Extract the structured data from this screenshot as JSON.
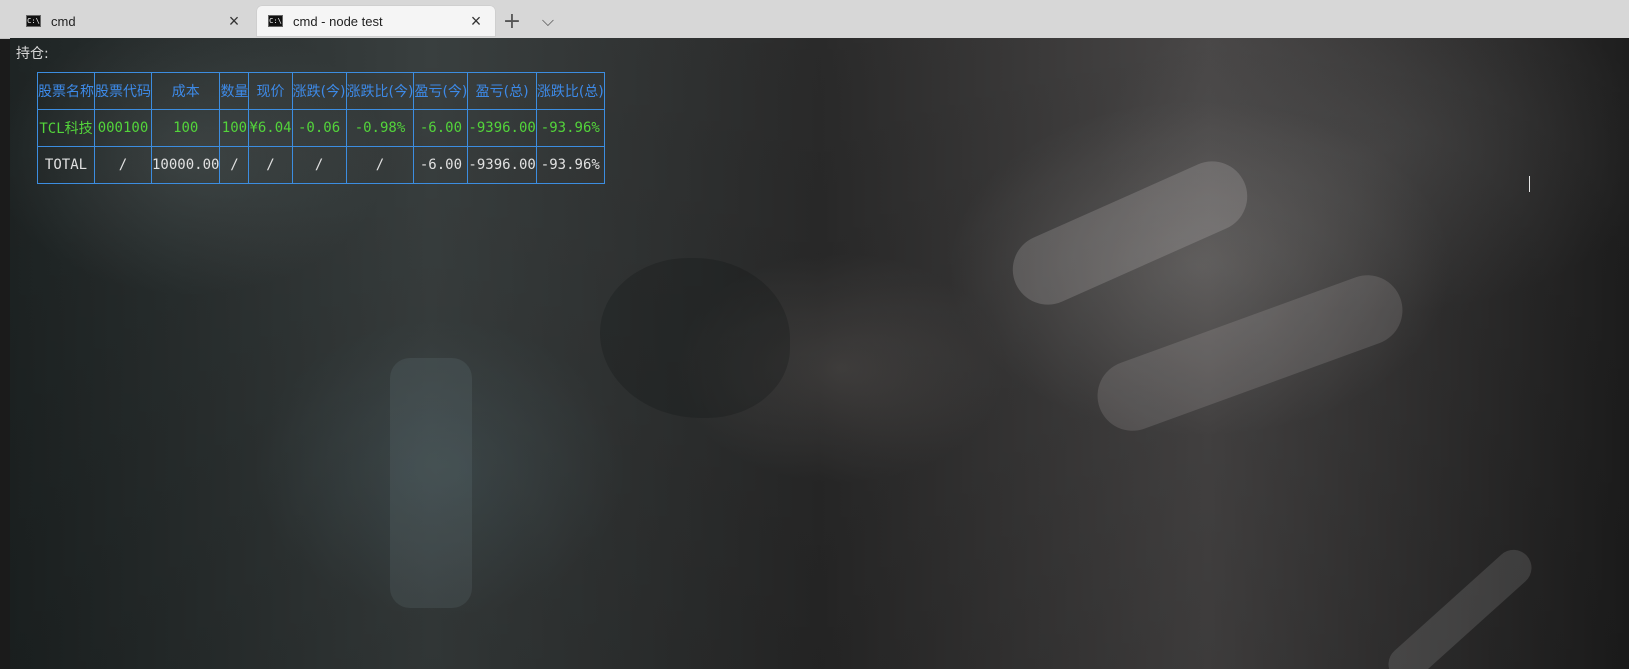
{
  "tabs": [
    {
      "title": "cmd",
      "icon": "cmd-icon",
      "active": false
    },
    {
      "title": "cmd - node  test",
      "icon": "cmd-icon",
      "active": true
    }
  ],
  "actions": {
    "new_tab": "+",
    "dropdown": "⌵"
  },
  "terminal": {
    "label": "持仓:",
    "headers": [
      "股票名称",
      "股票代码",
      "成本",
      "数量",
      "现价",
      "涨跌(今)",
      "涨跌比(今)",
      "盈亏(今)",
      "盈亏(总)",
      "涨跌比(总)"
    ],
    "rows": [
      [
        "TCL科技",
        "000100",
        "100",
        "100",
        "¥6.04",
        "-0.06",
        "-0.98%",
        "-6.00",
        "-9396.00",
        "-93.96%"
      ],
      [
        "TOTAL",
        "/",
        "10000.00",
        "/",
        "/",
        "/",
        "/",
        "-6.00",
        "-9396.00",
        "-93.96%"
      ]
    ]
  },
  "colors": {
    "tab_bar": "#d7d7d7",
    "active_tab": "#f5f5f5",
    "table_border": "#3c8de0",
    "header_text": "#3d8ae8",
    "stock_row_text": "#53d43b",
    "total_row_text": "#e0e0e0"
  }
}
